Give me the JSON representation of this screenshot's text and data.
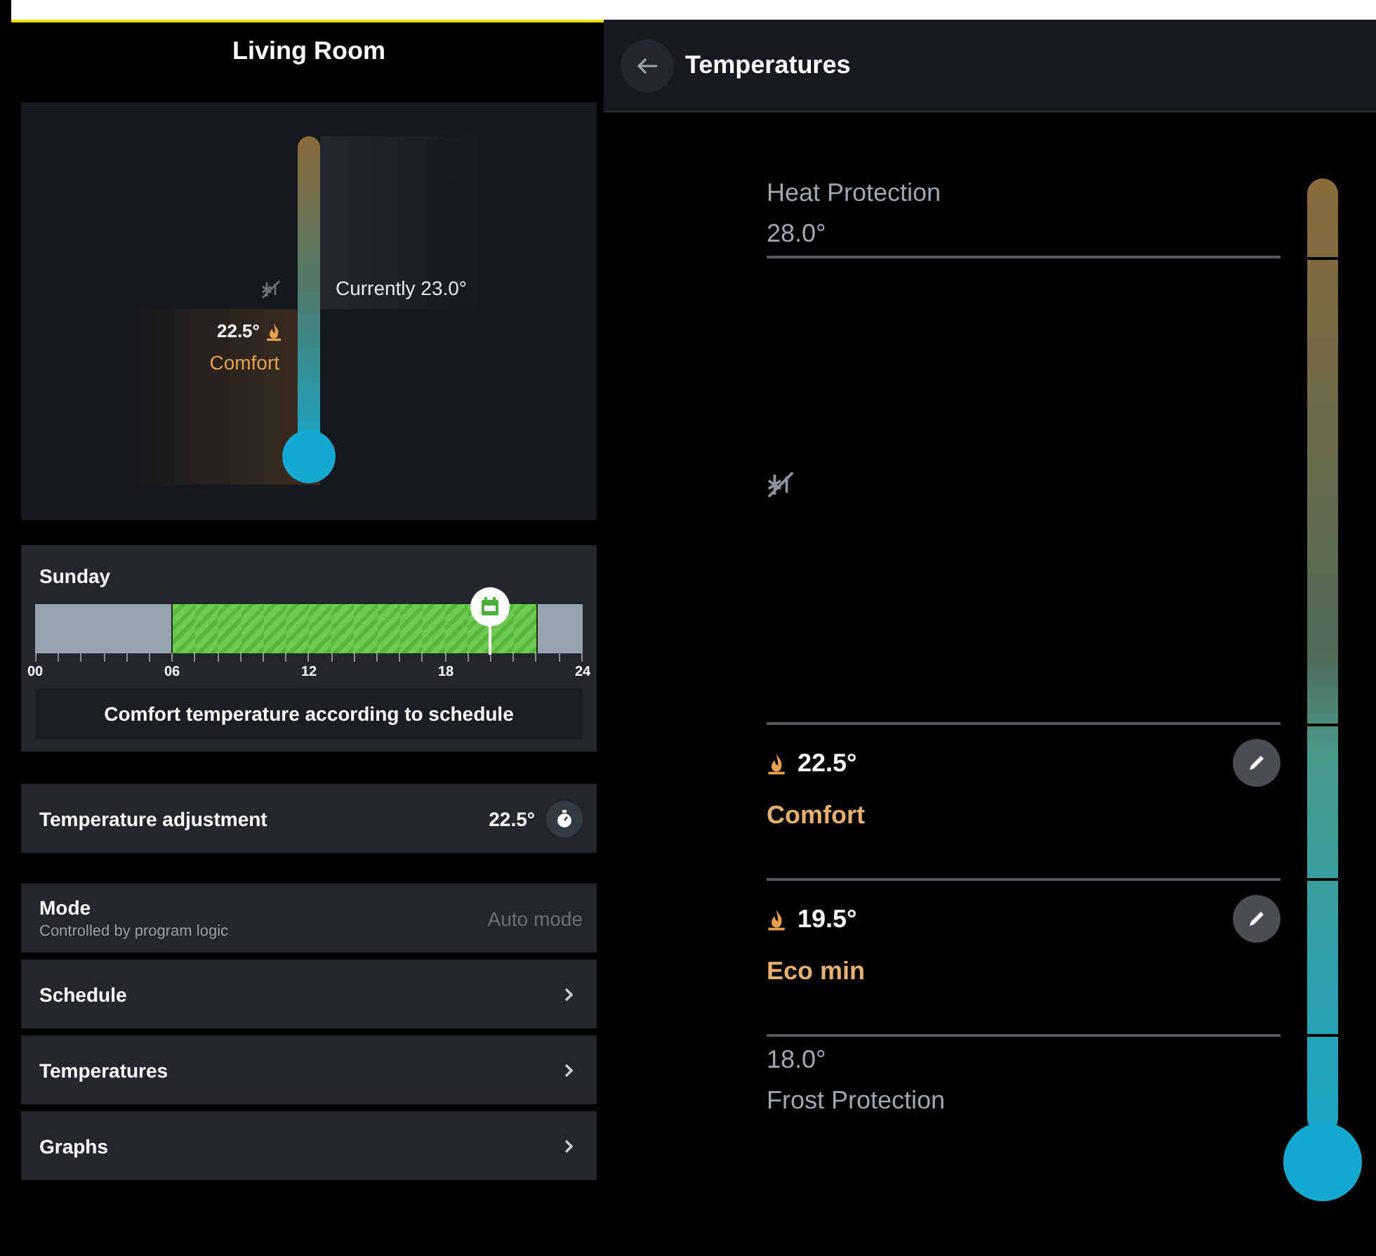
{
  "left": {
    "title": "Living Room",
    "thermometer": {
      "current": "Currently 23.0°",
      "target": "22.5°",
      "target_mode": "Comfort"
    },
    "schedule": {
      "day": "Sunday",
      "segments": [
        {
          "kind": "off",
          "now": false
        },
        {
          "kind": "off",
          "now": false
        },
        {
          "kind": "off",
          "now": false
        },
        {
          "kind": "off",
          "now": false
        },
        {
          "kind": "off",
          "now": false
        },
        {
          "kind": "off",
          "now": false
        },
        {
          "kind": "comfort",
          "now": false
        },
        {
          "kind": "comfort",
          "now": false
        },
        {
          "kind": "comfort",
          "now": false
        },
        {
          "kind": "comfort",
          "now": false
        },
        {
          "kind": "comfort",
          "now": false
        },
        {
          "kind": "comfort",
          "now": false
        },
        {
          "kind": "comfort",
          "now": false
        },
        {
          "kind": "comfort",
          "now": false
        },
        {
          "kind": "comfort",
          "now": false
        },
        {
          "kind": "comfort",
          "now": false
        },
        {
          "kind": "comfort",
          "now": false
        },
        {
          "kind": "comfort",
          "now": false
        },
        {
          "kind": "comfort",
          "now": false
        },
        {
          "kind": "comfort",
          "now": false
        },
        {
          "kind": "comfort",
          "now": true
        },
        {
          "kind": "comfort",
          "now": false
        },
        {
          "kind": "off",
          "now": false
        },
        {
          "kind": "off",
          "now": false
        }
      ],
      "ticks": [
        "00",
        "06",
        "12",
        "18",
        "24"
      ],
      "status": "Comfort temperature according to schedule"
    },
    "adjustment": {
      "label": "Temperature adjustment",
      "value": "22.5°"
    },
    "mode": {
      "label": "Mode",
      "description": "Controlled by program logic",
      "value": "Auto mode",
      "disabled": true
    },
    "menu": [
      {
        "label": "Schedule"
      },
      {
        "label": "Temperatures"
      },
      {
        "label": "Graphs"
      }
    ]
  },
  "right": {
    "title": "Temperatures",
    "levels": [
      {
        "kind": "limit",
        "name": "Heat Protection",
        "value": "28.0°"
      },
      {
        "kind": "gap"
      },
      {
        "kind": "editable",
        "value": "22.5°",
        "name": "Comfort"
      },
      {
        "kind": "editable",
        "value": "19.5°",
        "name": "Eco min"
      },
      {
        "kind": "floor",
        "value": "18.0°",
        "name": "Frost Protection"
      }
    ]
  }
}
